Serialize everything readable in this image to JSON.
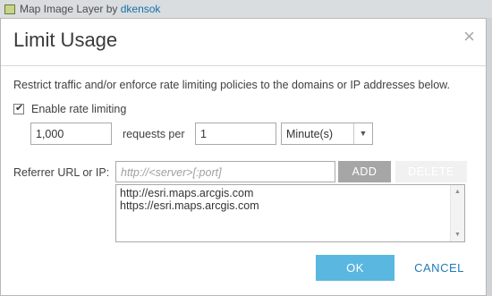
{
  "background": {
    "layer_title": "Map Image Layer by ",
    "layer_owner": "dkensok"
  },
  "dialog": {
    "title": "Limit Usage",
    "close_glyph": "×",
    "description": "Restrict traffic and/or enforce rate limiting policies to the domains or IP addresses below.",
    "rate_limiting": {
      "checkbox_label": "Enable rate limiting",
      "checked": true,
      "requests_value": "1,000",
      "requests_per_label": "requests per",
      "per_value": "1",
      "unit_selected": "Minute(s)"
    },
    "referrer": {
      "label": "Referrer URL or IP:",
      "placeholder": "http://<server>[:port]",
      "add_label": "ADD",
      "delete_label": "DELETE",
      "entries": [
        "http://esri.maps.arcgis.com",
        "https://esri.maps.arcgis.com"
      ]
    },
    "ok_label": "OK",
    "cancel_label": "CANCEL"
  },
  "colors": {
    "ok_button": "#59b7e0",
    "cancel_text": "#1f7ab8",
    "add_button": "#a6a6a6"
  },
  "icons": {
    "close": "close-icon",
    "checkbox": "checkmark-icon",
    "dropdown": "chevron-down-icon",
    "scroll_up": "scroll-up-icon",
    "scroll_down": "scroll-down-icon",
    "layer": "map-layer-icon"
  }
}
